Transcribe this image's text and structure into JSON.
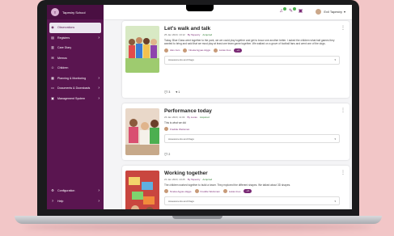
{
  "sidebar": {
    "brand": "Tapestry School",
    "items": [
      {
        "label": "Observations",
        "icon": "eye-icon",
        "active": true,
        "chevron": false
      },
      {
        "label": "Registers",
        "icon": "clipboard-icon",
        "active": false,
        "chevron": true
      },
      {
        "label": "Care Diary",
        "icon": "diary-icon",
        "active": false,
        "chevron": false
      },
      {
        "label": "Memos",
        "icon": "memo-icon",
        "active": false,
        "chevron": false
      },
      {
        "label": "Children",
        "icon": "children-icon",
        "active": false,
        "chevron": false
      },
      {
        "label": "Planning & Monitoring",
        "icon": "planning-icon",
        "active": false,
        "chevron": true
      },
      {
        "label": "Documents & Downloads",
        "icon": "folder-icon",
        "active": false,
        "chevron": true
      },
      {
        "label": "Management System",
        "icon": "management-icon",
        "active": false,
        "chevron": true
      }
    ],
    "bottom_items": [
      {
        "label": "Configuration",
        "icon": "gear-icon"
      },
      {
        "label": "Help",
        "icon": "help-icon"
      }
    ]
  },
  "topbar": {
    "user_name": "Evil Tapestry"
  },
  "feed": {
    "cards": [
      {
        "title": "Let's walk and talk",
        "date": "25 Jan 2023, 10:12",
        "author": "By Tapestry",
        "status": "Acquired",
        "description": "Today, Blue Class went together to the park, we we could play together and get to know one another better. I asked the children what ball games they wanted to bring and said that we must play at least one team game together. We walked on a grove of football fans and went one of the dogs.",
        "children": [
          "Alex Jam",
          "Nneka Agyao-Higgs",
          "Lukas Ines"
        ],
        "more_pill": "+4",
        "assessment_label": "Assessments and Flags",
        "comments": "3",
        "likes": "1"
      },
      {
        "title": "Performance today",
        "date": "23 Jan 2023, 11:04",
        "author": "By Lucas",
        "status": "Acquired",
        "description": "This is what we did",
        "children": [
          "Freddie Weitsman"
        ],
        "more_pill": "",
        "assessment_label": "Assessments and Flags",
        "comments": "2",
        "likes": ""
      },
      {
        "title": "Working together",
        "date": "21 Jan 2023, 10:25",
        "author": "By Tapestry",
        "status": "Acquired",
        "description": "The children worked together to build a tower. They explored the different shapes. We talked about 3D shapes.",
        "children": [
          "Nneka Agyao-Higgs",
          "Freddie Weitsman",
          "Lukas Ines"
        ],
        "more_pill": "+3",
        "assessment_label": "Assessments and Flags",
        "comments": "",
        "likes": ""
      }
    ]
  },
  "colors": {
    "brand": "#5a1550",
    "accent": "#7a2b75",
    "status": "#2e7d32"
  }
}
